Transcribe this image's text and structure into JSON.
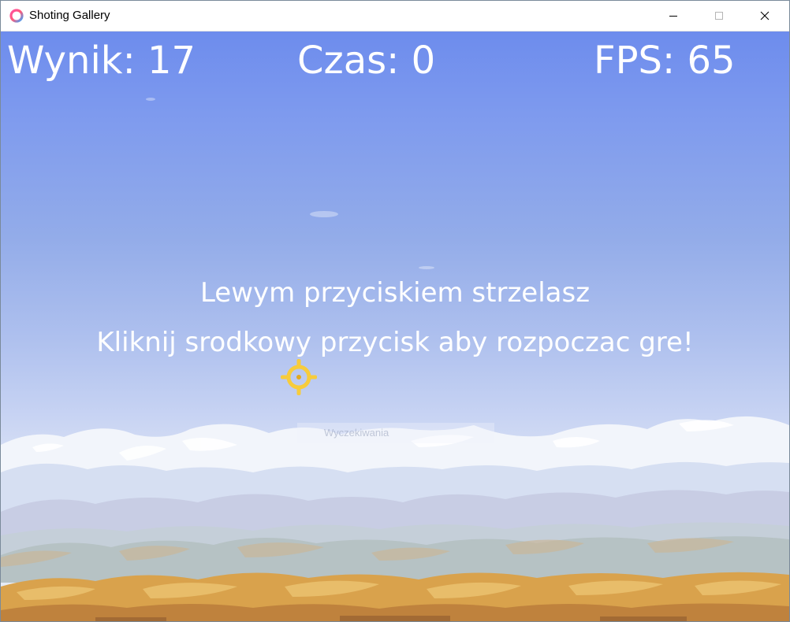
{
  "window": {
    "title": "Shoting Gallery",
    "icon": "app-ring-icon"
  },
  "hud": {
    "score_text": "Wynik: 17",
    "score": 17,
    "time_text": "Czas: 0",
    "time": 0,
    "fps_text": "FPS: 65",
    "fps": 65
  },
  "messages": {
    "line1": "Lewym przyciskiem strzelasz",
    "line2": "Kliknij srodkowy przycisk aby rozpoczac gre!"
  },
  "faint_label": "Wyczekiwania",
  "crosshair": {
    "icon": "crosshair-icon",
    "color": "#f7cc3c"
  },
  "colors": {
    "sky_top": "#6d8ced",
    "sky_bottom": "#e5ebf5",
    "text": "#ffffff",
    "sand": "#d9a24c"
  }
}
